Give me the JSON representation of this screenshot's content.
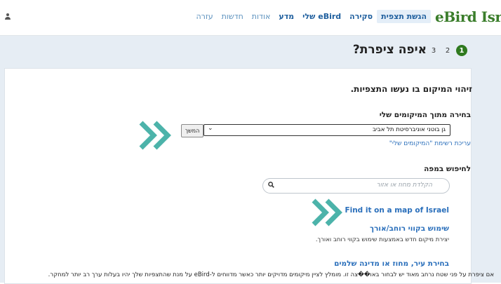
{
  "brand": {
    "logo_text": "eBird Israe"
  },
  "nav": {
    "items": [
      {
        "label": "הגשת תצפית",
        "active": true
      },
      {
        "label": "סקירה",
        "active": false
      },
      {
        "label": "eBird שלי",
        "active": false
      },
      {
        "label": "מדע",
        "active": false
      },
      {
        "label": "אודות",
        "muted": true
      },
      {
        "label": "חדשות",
        "muted": true
      },
      {
        "label": "עזרה",
        "muted": true
      }
    ]
  },
  "stepper": {
    "steps": [
      "1",
      "2",
      "3"
    ],
    "active": "1"
  },
  "page_title": "איפה ציפרת?",
  "section": {
    "heading": "זיהוי המיקום בו נעשו התצפיות.",
    "my_locations": {
      "heading": "בחירה מתוך המיקומים שלי",
      "selected": "גן בוטני אוניברסיטת תל אביב",
      "continue_label": "המשך",
      "edit_link": "עריכת רשימת \"המיקומים שלי\""
    },
    "map_search": {
      "heading": "לחיפוש במפה",
      "placeholder": "הקלדת מחוז או אזור"
    },
    "find_on_map": "Find it on a map of Israel",
    "coords": {
      "heading": "שימוש בקווי רוחב/אורך",
      "description": "יצירת מיקום חדש באמצעות שימוש בקווי רוחב ואורך."
    },
    "region": {
      "heading": "בחירת עיר, מחוז או מדינה שלמים",
      "description": "אם ציפרת על פני שטח נרחב מאוד יש לבחור באו��צה זו. מומלץ לציין מיקומים מדויקים יותר כאשר מדווחים ל-eBird על מנת שהתצפיות שלך יהיו בעלות ערך רב יותר למחקר."
    }
  },
  "colors": {
    "accent": "#2f7a1f",
    "link": "#2a6fbb",
    "arrow": "#4cb3aa",
    "band": "#e6edf4"
  },
  "icons": [
    "user-icon",
    "search-icon",
    "chevron-down-icon",
    "double-chevron-arrow-icon"
  ]
}
